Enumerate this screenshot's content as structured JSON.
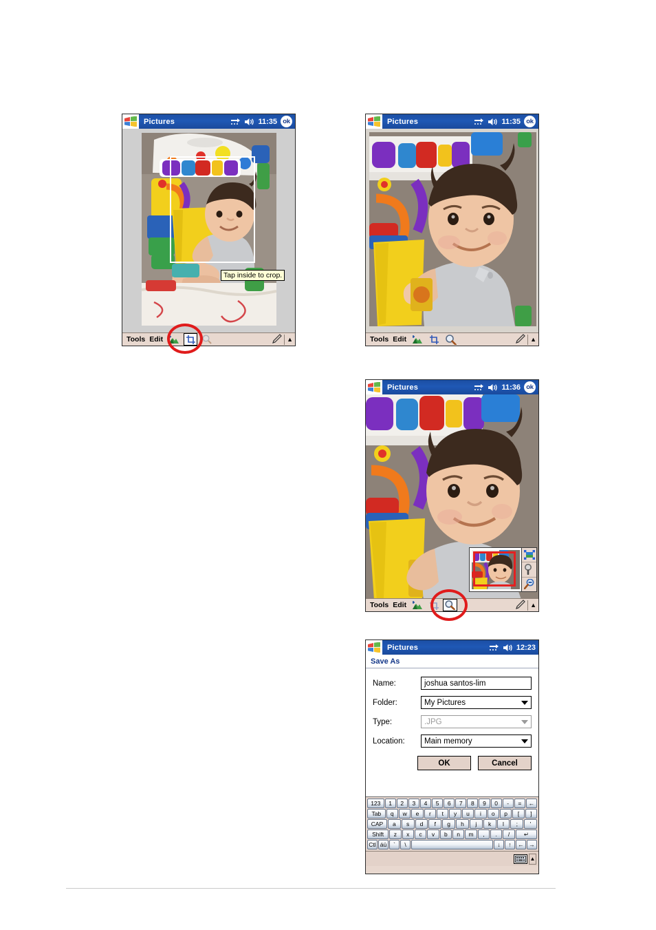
{
  "page": {
    "background": "#ffffff",
    "rule_color": "#c9c9c9"
  },
  "panels": [
    {
      "id": "crop-step",
      "title": "Pictures",
      "time": "11:35",
      "ok_label": "ok",
      "tooltip": "Tap inside to crop.",
      "toolbar": {
        "tools_label": "Tools",
        "edit_label": "Edit",
        "icons": [
          "picture-icon",
          "crop-icon",
          "zoom-icon"
        ],
        "selected_icon": "crop-icon",
        "pen_icon": "pen-icon",
        "updown_icon": "up-arrow-icon"
      },
      "annotation": {
        "shape": "circle",
        "color": "#e01b1b",
        "target": "crop-icon"
      }
    },
    {
      "id": "cropped-result",
      "title": "Pictures",
      "time": "11:35",
      "ok_label": "ok",
      "toolbar": {
        "tools_label": "Tools",
        "edit_label": "Edit",
        "icons": [
          "picture-icon",
          "crop-icon",
          "zoom-icon"
        ],
        "selected_icon": null,
        "pen_icon": "pen-icon",
        "updown_icon": "up-arrow-icon"
      }
    },
    {
      "id": "zoom-step",
      "title": "Pictures",
      "time": "11:36",
      "ok_label": "ok",
      "toolbar": {
        "tools_label": "Tools",
        "edit_label": "Edit",
        "icons": [
          "picture-icon",
          "crop-icon",
          "zoom-icon"
        ],
        "selected_icon": "zoom-icon",
        "pen_icon": "pen-icon",
        "updown_icon": "up-arrow-icon"
      },
      "zoom_panel": {
        "buttons": [
          "fit-to-window-icon",
          "zoom-in-icon",
          "zoom-out-icon"
        ],
        "selection_color": "#e42020"
      },
      "annotation": {
        "shape": "circle",
        "color": "#e01b1b",
        "target": "zoom-icon"
      }
    }
  ],
  "save_dialog": {
    "title": "Pictures",
    "time": "12:23",
    "header": "Save As",
    "fields": [
      {
        "label": "Name:",
        "value": "joshua santos-lim",
        "type": "text",
        "disabled": false
      },
      {
        "label": "Folder:",
        "value": "My Pictures",
        "type": "select",
        "disabled": false
      },
      {
        "label": "Type:",
        "value": ".JPG",
        "type": "select",
        "disabled": true
      },
      {
        "label": "Location:",
        "value": "Main memory",
        "type": "select",
        "disabled": false
      }
    ],
    "buttons": {
      "ok": "OK",
      "cancel": "Cancel"
    },
    "keyboard": {
      "rows": [
        [
          "123",
          "1",
          "2",
          "3",
          "4",
          "5",
          "6",
          "7",
          "8",
          "9",
          "0",
          "-",
          "=",
          "←"
        ],
        [
          "Tab",
          "q",
          "w",
          "e",
          "r",
          "t",
          "y",
          "u",
          "i",
          "o",
          "p",
          "[",
          "]"
        ],
        [
          "CAP",
          "a",
          "s",
          "d",
          "f",
          "g",
          "h",
          "j",
          "k",
          "l",
          ";",
          "'"
        ],
        [
          "Shift",
          "z",
          "x",
          "c",
          "v",
          "b",
          "n",
          "m",
          ",",
          ".",
          "/",
          "↵"
        ],
        [
          "Ctl",
          "áü",
          "`",
          "\\",
          " ",
          "↓",
          "↑",
          "←",
          "→"
        ]
      ],
      "status_icons": [
        "keyboard-icon",
        "input-selector-icon"
      ]
    }
  }
}
